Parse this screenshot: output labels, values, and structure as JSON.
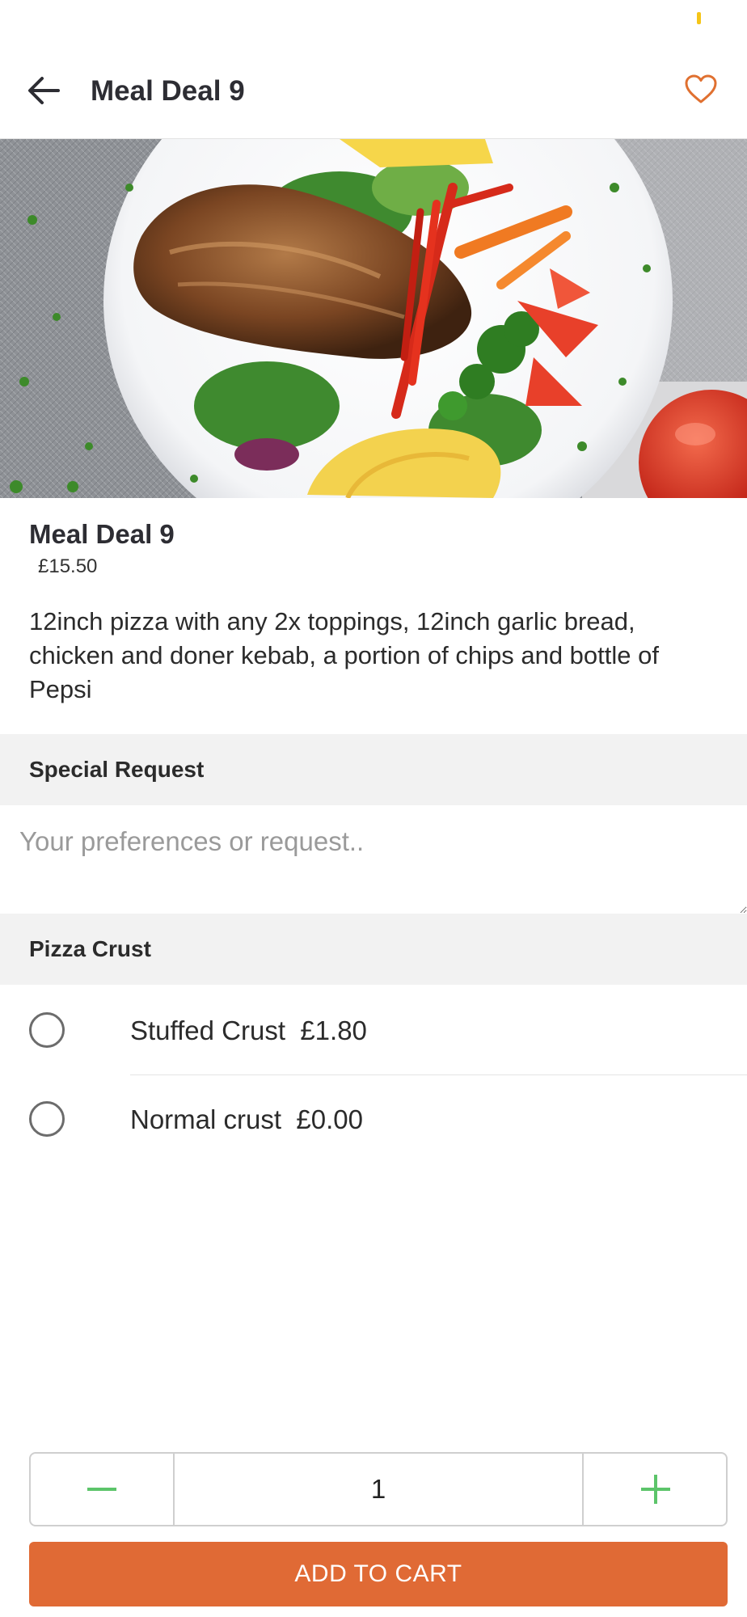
{
  "header": {
    "title": "Meal Deal 9"
  },
  "item": {
    "name": "Meal Deal 9",
    "price": "£15.50",
    "description": "12inch pizza with any 2x toppings, 12inch garlic bread, chicken and doner kebab, a portion of chips and bottle of Pepsi"
  },
  "special_request": {
    "heading": "Special Request",
    "placeholder": "Your preferences or request..",
    "value": ""
  },
  "pizza_crust": {
    "heading": "Pizza Crust",
    "options": [
      {
        "label": "Stuffed Crust  £1.80",
        "selected": false
      },
      {
        "label": "Normal crust  £0.00",
        "selected": false
      }
    ]
  },
  "quantity": {
    "value": "1"
  },
  "cart": {
    "button_label": "ADD TO CART"
  },
  "icons": {
    "back": "arrow-left-icon",
    "favorite": "heart-icon",
    "minus": "minus-icon",
    "plus": "plus-icon"
  },
  "colors": {
    "accent": "#e06a35",
    "heart": "#e07030",
    "stepper": "#5cc46a",
    "section_bg": "#f2f2f2"
  }
}
